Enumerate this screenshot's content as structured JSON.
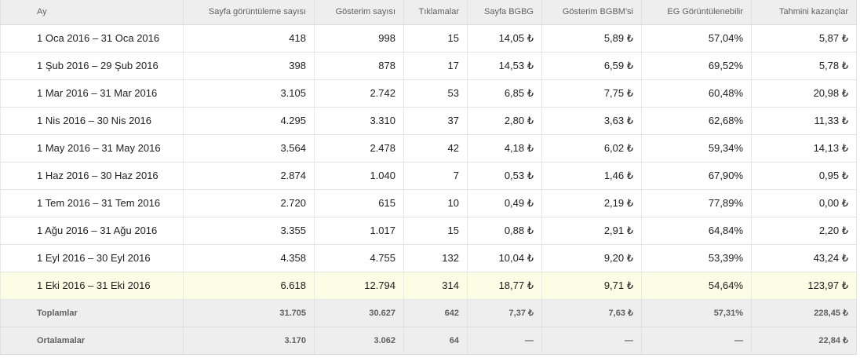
{
  "table": {
    "columns": [
      "Ay",
      "Sayfa görüntüleme sayısı",
      "Gösterim sayısı",
      "Tıklamalar",
      "Sayfa BGBG",
      "Gösterim BGBM'si",
      "EG Görüntülenebilir",
      "Tahmini kazançlar"
    ],
    "rows": [
      [
        "1 Oca 2016 – 31 Oca 2016",
        "418",
        "998",
        "15",
        "14,05 ₺",
        "5,89 ₺",
        "57,04%",
        "5,87 ₺"
      ],
      [
        "1 Şub 2016 – 29 Şub 2016",
        "398",
        "878",
        "17",
        "14,53 ₺",
        "6,59 ₺",
        "69,52%",
        "5,78 ₺"
      ],
      [
        "1 Mar 2016 – 31 Mar 2016",
        "3.105",
        "2.742",
        "53",
        "6,85 ₺",
        "7,75 ₺",
        "60,48%",
        "20,98 ₺"
      ],
      [
        "1 Nis 2016 – 30 Nis 2016",
        "4.295",
        "3.310",
        "37",
        "2,80 ₺",
        "3,63 ₺",
        "62,68%",
        "11,33 ₺"
      ],
      [
        "1 May 2016 – 31 May 2016",
        "3.564",
        "2.478",
        "42",
        "4,18 ₺",
        "6,02 ₺",
        "59,34%",
        "14,13 ₺"
      ],
      [
        "1 Haz 2016 – 30 Haz 2016",
        "2.874",
        "1.040",
        "7",
        "0,53 ₺",
        "1,46 ₺",
        "67,90%",
        "0,95 ₺"
      ],
      [
        "1 Tem 2016 – 31 Tem 2016",
        "2.720",
        "615",
        "10",
        "0,49 ₺",
        "2,19 ₺",
        "77,89%",
        "0,00 ₺"
      ],
      [
        "1 Ağu 2016 – 31 Ağu 2016",
        "3.355",
        "1.017",
        "15",
        "0,88 ₺",
        "2,91 ₺",
        "64,84%",
        "2,20 ₺"
      ],
      [
        "1 Eyl 2016 – 30 Eyl 2016",
        "4.358",
        "4.755",
        "132",
        "10,04 ₺",
        "9,20 ₺",
        "53,39%",
        "43,24 ₺"
      ],
      [
        "1 Eki 2016 – 31 Eki 2016",
        "6.618",
        "12.794",
        "314",
        "18,77 ₺",
        "9,71 ₺",
        "54,64%",
        "123,97 ₺"
      ]
    ],
    "footer": [
      [
        "Toplamlar",
        "31.705",
        "30.627",
        "642",
        "7,37 ₺",
        "7,63 ₺",
        "57,31%",
        "228,45 ₺"
      ],
      [
        "Ortalamalar",
        "3.170",
        "3.062",
        "64",
        "—",
        "—",
        "—",
        "22,84 ₺"
      ]
    ],
    "highlight_color": "#fcfde5",
    "header_bg": "#eeeeee"
  }
}
